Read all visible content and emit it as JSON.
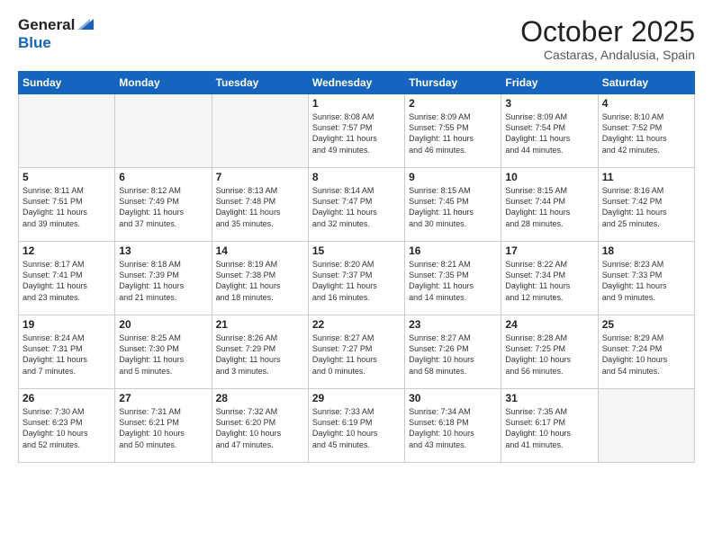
{
  "logo": {
    "general": "General",
    "blue": "Blue"
  },
  "header": {
    "month": "October 2025",
    "location": "Castaras, Andalusia, Spain"
  },
  "weekdays": [
    "Sunday",
    "Monday",
    "Tuesday",
    "Wednesday",
    "Thursday",
    "Friday",
    "Saturday"
  ],
  "weeks": [
    [
      {
        "day": "",
        "info": ""
      },
      {
        "day": "",
        "info": ""
      },
      {
        "day": "",
        "info": ""
      },
      {
        "day": "1",
        "info": "Sunrise: 8:08 AM\nSunset: 7:57 PM\nDaylight: 11 hours\nand 49 minutes."
      },
      {
        "day": "2",
        "info": "Sunrise: 8:09 AM\nSunset: 7:55 PM\nDaylight: 11 hours\nand 46 minutes."
      },
      {
        "day": "3",
        "info": "Sunrise: 8:09 AM\nSunset: 7:54 PM\nDaylight: 11 hours\nand 44 minutes."
      },
      {
        "day": "4",
        "info": "Sunrise: 8:10 AM\nSunset: 7:52 PM\nDaylight: 11 hours\nand 42 minutes."
      }
    ],
    [
      {
        "day": "5",
        "info": "Sunrise: 8:11 AM\nSunset: 7:51 PM\nDaylight: 11 hours\nand 39 minutes."
      },
      {
        "day": "6",
        "info": "Sunrise: 8:12 AM\nSunset: 7:49 PM\nDaylight: 11 hours\nand 37 minutes."
      },
      {
        "day": "7",
        "info": "Sunrise: 8:13 AM\nSunset: 7:48 PM\nDaylight: 11 hours\nand 35 minutes."
      },
      {
        "day": "8",
        "info": "Sunrise: 8:14 AM\nSunset: 7:47 PM\nDaylight: 11 hours\nand 32 minutes."
      },
      {
        "day": "9",
        "info": "Sunrise: 8:15 AM\nSunset: 7:45 PM\nDaylight: 11 hours\nand 30 minutes."
      },
      {
        "day": "10",
        "info": "Sunrise: 8:15 AM\nSunset: 7:44 PM\nDaylight: 11 hours\nand 28 minutes."
      },
      {
        "day": "11",
        "info": "Sunrise: 8:16 AM\nSunset: 7:42 PM\nDaylight: 11 hours\nand 25 minutes."
      }
    ],
    [
      {
        "day": "12",
        "info": "Sunrise: 8:17 AM\nSunset: 7:41 PM\nDaylight: 11 hours\nand 23 minutes."
      },
      {
        "day": "13",
        "info": "Sunrise: 8:18 AM\nSunset: 7:39 PM\nDaylight: 11 hours\nand 21 minutes."
      },
      {
        "day": "14",
        "info": "Sunrise: 8:19 AM\nSunset: 7:38 PM\nDaylight: 11 hours\nand 18 minutes."
      },
      {
        "day": "15",
        "info": "Sunrise: 8:20 AM\nSunset: 7:37 PM\nDaylight: 11 hours\nand 16 minutes."
      },
      {
        "day": "16",
        "info": "Sunrise: 8:21 AM\nSunset: 7:35 PM\nDaylight: 11 hours\nand 14 minutes."
      },
      {
        "day": "17",
        "info": "Sunrise: 8:22 AM\nSunset: 7:34 PM\nDaylight: 11 hours\nand 12 minutes."
      },
      {
        "day": "18",
        "info": "Sunrise: 8:23 AM\nSunset: 7:33 PM\nDaylight: 11 hours\nand 9 minutes."
      }
    ],
    [
      {
        "day": "19",
        "info": "Sunrise: 8:24 AM\nSunset: 7:31 PM\nDaylight: 11 hours\nand 7 minutes."
      },
      {
        "day": "20",
        "info": "Sunrise: 8:25 AM\nSunset: 7:30 PM\nDaylight: 11 hours\nand 5 minutes."
      },
      {
        "day": "21",
        "info": "Sunrise: 8:26 AM\nSunset: 7:29 PM\nDaylight: 11 hours\nand 3 minutes."
      },
      {
        "day": "22",
        "info": "Sunrise: 8:27 AM\nSunset: 7:27 PM\nDaylight: 11 hours\nand 0 minutes."
      },
      {
        "day": "23",
        "info": "Sunrise: 8:27 AM\nSunset: 7:26 PM\nDaylight: 10 hours\nand 58 minutes."
      },
      {
        "day": "24",
        "info": "Sunrise: 8:28 AM\nSunset: 7:25 PM\nDaylight: 10 hours\nand 56 minutes."
      },
      {
        "day": "25",
        "info": "Sunrise: 8:29 AM\nSunset: 7:24 PM\nDaylight: 10 hours\nand 54 minutes."
      }
    ],
    [
      {
        "day": "26",
        "info": "Sunrise: 7:30 AM\nSunset: 6:23 PM\nDaylight: 10 hours\nand 52 minutes."
      },
      {
        "day": "27",
        "info": "Sunrise: 7:31 AM\nSunset: 6:21 PM\nDaylight: 10 hours\nand 50 minutes."
      },
      {
        "day": "28",
        "info": "Sunrise: 7:32 AM\nSunset: 6:20 PM\nDaylight: 10 hours\nand 47 minutes."
      },
      {
        "day": "29",
        "info": "Sunrise: 7:33 AM\nSunset: 6:19 PM\nDaylight: 10 hours\nand 45 minutes."
      },
      {
        "day": "30",
        "info": "Sunrise: 7:34 AM\nSunset: 6:18 PM\nDaylight: 10 hours\nand 43 minutes."
      },
      {
        "day": "31",
        "info": "Sunrise: 7:35 AM\nSunset: 6:17 PM\nDaylight: 10 hours\nand 41 minutes."
      },
      {
        "day": "",
        "info": ""
      }
    ]
  ]
}
